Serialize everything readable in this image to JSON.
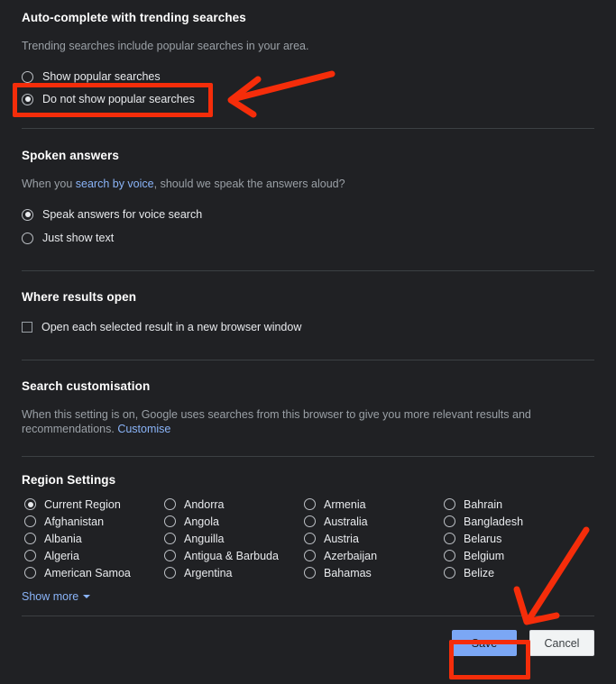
{
  "theme": {
    "background": "#202124",
    "text": "#e8eaed",
    "muted": "#9aa0a6",
    "link": "#8ab4f8",
    "divider": "#3c4043",
    "highlight": "#f52d0a",
    "save_bg": "#7ba7f5",
    "cancel_bg": "#f1f3f4"
  },
  "autocomplete": {
    "title": "Auto-complete with trending searches",
    "description": "Trending searches include popular searches in your area.",
    "options": [
      {
        "label": "Show popular searches",
        "selected": false
      },
      {
        "label": "Do not show popular searches",
        "selected": true
      }
    ]
  },
  "spoken": {
    "title": "Spoken answers",
    "desc_before": "When you ",
    "desc_link": "search by voice",
    "desc_after": ", should we speak the answers aloud?",
    "options": [
      {
        "label": "Speak answers for voice search",
        "selected": true
      },
      {
        "label": "Just show text",
        "selected": false
      }
    ]
  },
  "results_open": {
    "title": "Where results open",
    "checkbox_label": "Open each selected result in a new browser window",
    "checked": false
  },
  "customisation": {
    "title": "Search customisation",
    "desc_before": "When this setting is on, Google uses searches from this browser to give you more relevant results and recommendations. ",
    "desc_link": "Customise"
  },
  "region": {
    "title": "Region Settings",
    "show_more_label": "Show more",
    "show_more_icon": "chevron-down-icon",
    "items": [
      {
        "label": "Current Region",
        "selected": true
      },
      {
        "label": "Andorra",
        "selected": false
      },
      {
        "label": "Armenia",
        "selected": false
      },
      {
        "label": "Bahrain",
        "selected": false
      },
      {
        "label": "Afghanistan",
        "selected": false
      },
      {
        "label": "Angola",
        "selected": false
      },
      {
        "label": "Australia",
        "selected": false
      },
      {
        "label": "Bangladesh",
        "selected": false
      },
      {
        "label": "Albania",
        "selected": false
      },
      {
        "label": "Anguilla",
        "selected": false
      },
      {
        "label": "Austria",
        "selected": false
      },
      {
        "label": "Belarus",
        "selected": false
      },
      {
        "label": "Algeria",
        "selected": false
      },
      {
        "label": "Antigua & Barbuda",
        "selected": false
      },
      {
        "label": "Azerbaijan",
        "selected": false
      },
      {
        "label": "Belgium",
        "selected": false
      },
      {
        "label": "American Samoa",
        "selected": false
      },
      {
        "label": "Argentina",
        "selected": false
      },
      {
        "label": "Bahamas",
        "selected": false
      },
      {
        "label": "Belize",
        "selected": false
      }
    ]
  },
  "footer": {
    "save_label": "Save",
    "cancel_label": "Cancel"
  }
}
